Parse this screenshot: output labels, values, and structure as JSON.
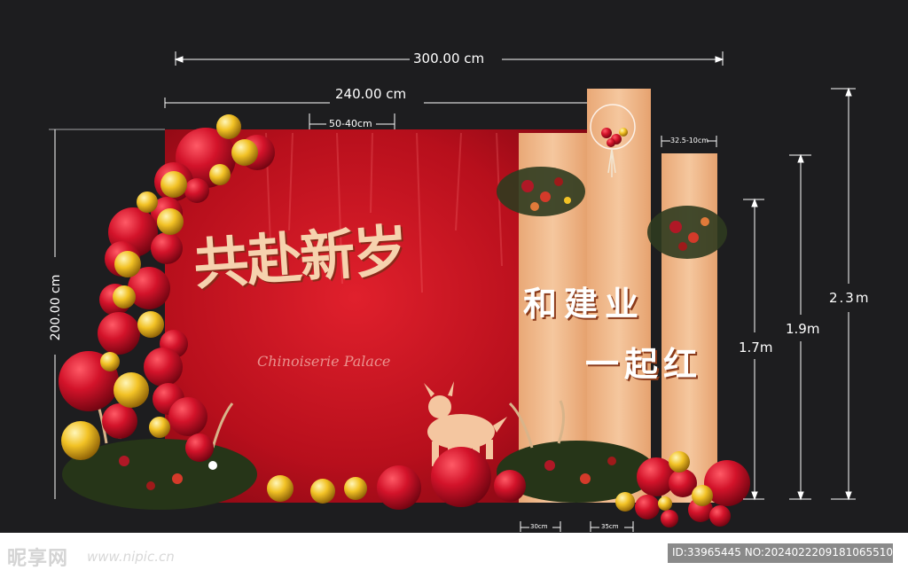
{
  "design": {
    "headline": "共赴新岁",
    "slogan_line1": "和建业",
    "slogan_line2": "一起红",
    "script_text": "Chinoiserie Palace"
  },
  "dimensions": {
    "total_width": "300.00 cm",
    "backdrop_width": "240.00 cm",
    "backdrop_height": "200.00 cm",
    "cutout_width": "50-40cm",
    "panel_width_small": "32.5-10cm",
    "height_tall": "2.3m",
    "height_mid": "1.9m",
    "height_short": "1.7m",
    "base_width_1": "30cm",
    "base_width_2": "35cm"
  },
  "watermark": {
    "logo": "昵享网",
    "url": "www.nipic.cn",
    "id_line": "ID:33965445 NO:20240222091810655107"
  },
  "colors": {
    "background": "#1d1d1f",
    "backdrop_red": "#c8101e",
    "panel_peach": "#f0b98c",
    "text_gold": "#f6d2ae"
  }
}
